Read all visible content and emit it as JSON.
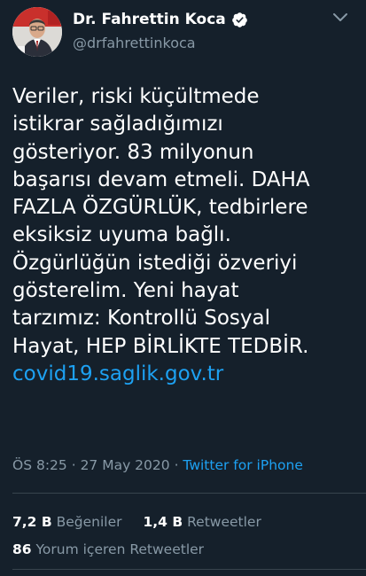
{
  "author": {
    "name": "Dr. Fahrettin Koca",
    "handle": "@drfahrettinkoca",
    "verified": true,
    "avatar_icon": "profile-avatar"
  },
  "tweet": {
    "lines": [
      "Veriler, riski küçültmede",
      "istikrar sağladığımızı",
      "gösteriyor. 83 milyonun",
      "başarısı devam etmeli. DAHA",
      "FAZLA ÖZGÜRLÜK, tedbirlere",
      "eksiksiz uyuma bağlı.",
      "Özgürlüğün istediği özveriyi",
      "gösterelim. Yeni hayat",
      "tarzımız: Kontrollü Sosyal",
      "Hayat, HEP BİRLİKTE TEDBİR."
    ],
    "link": "covid19.saglik.gov.tr"
  },
  "meta": {
    "time": "ÖS 8:25",
    "separator1": " · ",
    "date": "27 May 2020",
    "separator2": " · ",
    "source": "Twitter for iPhone"
  },
  "stats": {
    "likes_count": "7,2 B",
    "likes_label": "Beğeniler",
    "retweets_count": "1,4 B",
    "retweets_label": "Retweetler",
    "quote_count": "86",
    "quote_label": "Yorum içeren Retweetler"
  },
  "colors": {
    "background": "#15202b",
    "accent": "#1da1f2",
    "secondary_text": "#8899a6",
    "divider": "#38444d"
  }
}
